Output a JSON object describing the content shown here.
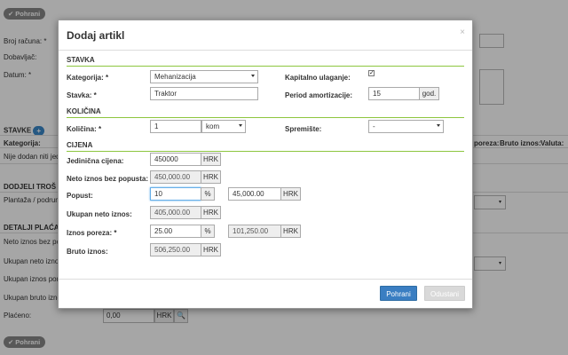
{
  "background": {
    "save_label": "Pohrani",
    "labels": {
      "broj_racuna": "Broj računa: *",
      "dobavljac": "Dobavljač:",
      "datum": "Datum: *",
      "stavke": "STAVKE",
      "kategorija": "Kategorija:",
      "nije_dodan": "Nije dodan niti jedan",
      "poreza": "poreza:",
      "bruto_iznos": "Bruto iznos:",
      "valuta": "Valuta:",
      "dodjeli_troskove": "DODJELI TROŠ",
      "plantaza": "Plantaža / podrum",
      "detalji_placanja": "DETALJI PLAĆAN",
      "neto_iznos_bez": "Neto iznos bez po",
      "ukupan_neto": "Ukupan neto iznos",
      "ukupan_iznos_por": "Ukupan iznos por",
      "ukupan_bruto": "Ukupan bruto izno",
      "placeno": "Plaćeno:"
    },
    "placeno_value": "0,00",
    "placeno_currency": "HRK"
  },
  "modal": {
    "title": "Dodaj artikl",
    "close": "×",
    "sections": {
      "stavka": "STAVKA",
      "kolicina": "KOLIČINA",
      "cijena": "CIJENA"
    },
    "fields": {
      "kategorija": {
        "label": "Kategorija: *",
        "value": "Mehanizacija"
      },
      "kapitalno": {
        "label": "Kapitalno ulaganje:",
        "checked": "✓"
      },
      "stavka": {
        "label": "Stavka: *",
        "value": "Traktor"
      },
      "period": {
        "label": "Period amortizacije:",
        "value": "15",
        "unit": "god."
      },
      "kolicina": {
        "label": "Količina: *",
        "value": "1",
        "unit": "kom"
      },
      "spremiste": {
        "label": "Spremište:",
        "value": "-"
      },
      "jedinicna": {
        "label": "Jedinična cijena:",
        "value": "450000",
        "currency": "HRK"
      },
      "neto_bez_popusta": {
        "label": "Neto iznos bez popusta:",
        "value": "450,000.00",
        "currency": "HRK"
      },
      "popust": {
        "label": "Popust:",
        "value": "10",
        "unit": "%",
        "amount": "45,000.00",
        "currency": "HRK"
      },
      "ukupan_neto": {
        "label": "Ukupan neto iznos:",
        "value": "405,000.00",
        "currency": "HRK"
      },
      "iznos_poreza": {
        "label": "Iznos poreza: *",
        "value": "25.00",
        "unit": "%",
        "amount": "101,250.00",
        "currency": "HRK"
      },
      "bruto": {
        "label": "Bruto iznos:",
        "value": "506,250.00",
        "currency": "HRK"
      }
    },
    "buttons": {
      "save": "Pohrani",
      "cancel": "Odustani"
    },
    "colors": {
      "accent": "#8dc63f",
      "primary": "#3a7ec2"
    }
  }
}
